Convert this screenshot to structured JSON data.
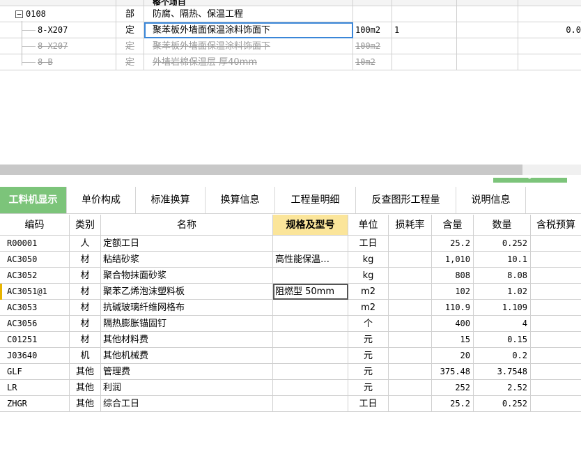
{
  "top": {
    "header_partial": "整个项目",
    "rows": [
      {
        "code": "0108",
        "type": "部",
        "name": "防腐、隔热、保温工程",
        "unit": "",
        "qty": "",
        "amount": "",
        "expander": "−",
        "strike": false
      },
      {
        "code": "8-X207",
        "type": "定",
        "name": "聚苯板外墙面保温涂料饰面下",
        "unit": "100m2",
        "qty": "1",
        "amount": "0.0",
        "strike": false
      },
      {
        "code": "8-X207",
        "type": "定",
        "name": "聚苯板外墙面保温涂料饰面下",
        "unit": "100m2",
        "qty": "",
        "amount": "",
        "strike": true
      },
      {
        "code": "8-B",
        "type": "定",
        "name": "外墙岩棉保温层 厚40mm",
        "unit": "10m2",
        "qty": "",
        "amount": "",
        "strike": true
      }
    ]
  },
  "tabs": [
    {
      "label": "工料机显示",
      "active": true
    },
    {
      "label": "单价构成",
      "active": false
    },
    {
      "label": "标准换算",
      "active": false
    },
    {
      "label": "换算信息",
      "active": false
    },
    {
      "label": "工程量明细",
      "active": false
    },
    {
      "label": "反查图形工程量",
      "active": false
    },
    {
      "label": "说明信息",
      "active": false
    }
  ],
  "grid": {
    "headers": [
      "编码",
      "类别",
      "名称",
      "规格及型号",
      "单位",
      "损耗率",
      "含量",
      "数量",
      "含税预算"
    ],
    "rows": [
      {
        "code": "R00001",
        "cat": "人",
        "name": "定额工日",
        "spec": "",
        "unit": "工日",
        "loss": "",
        "content": "25.2",
        "qty": "0.252"
      },
      {
        "code": "AC3050",
        "cat": "材",
        "name": "粘结砂浆",
        "spec": "高性能保温…",
        "unit": "kg",
        "loss": "",
        "content": "1,010",
        "qty": "10.1"
      },
      {
        "code": "AC3052",
        "cat": "材",
        "name": "聚合物抹面砂浆",
        "spec": "",
        "unit": "kg",
        "loss": "",
        "content": "808",
        "qty": "8.08"
      },
      {
        "code": "AC3051@1",
        "cat": "材",
        "name": "聚苯乙烯泡沫塑料板",
        "spec": "阻燃型 50mm",
        "unit": "m2",
        "loss": "",
        "content": "102",
        "qty": "1.02"
      },
      {
        "code": "AC3053",
        "cat": "材",
        "name": "抗碱玻璃纤维网格布",
        "spec": "",
        "unit": "m2",
        "loss": "",
        "content": "110.9",
        "qty": "1.109"
      },
      {
        "code": "AC3056",
        "cat": "材",
        "name": "隔热膨胀锚固钉",
        "spec": "",
        "unit": "个",
        "loss": "",
        "content": "400",
        "qty": "4"
      },
      {
        "code": "C01251",
        "cat": "材",
        "name": "其他材料费",
        "spec": "",
        "unit": "元",
        "loss": "",
        "content": "15",
        "qty": "0.15"
      },
      {
        "code": "J03640",
        "cat": "机",
        "name": "其他机械费",
        "spec": "",
        "unit": "元",
        "loss": "",
        "content": "20",
        "qty": "0.2"
      },
      {
        "code": "GLF",
        "cat": "其他",
        "name": "管理费",
        "spec": "",
        "unit": "元",
        "loss": "",
        "content": "375.48",
        "qty": "3.7548"
      },
      {
        "code": "LR",
        "cat": "其他",
        "name": "利润",
        "spec": "",
        "unit": "元",
        "loss": "",
        "content": "252",
        "qty": "2.52"
      },
      {
        "code": "ZHGR",
        "cat": "其他",
        "name": "综合工日",
        "spec": "",
        "unit": "工日",
        "loss": "",
        "content": "25.2",
        "qty": "0.252"
      }
    ]
  },
  "colors": {
    "accent_green": "#7cc47a",
    "header_highlight": "#fbe59a",
    "selection_blue": "#3a86d8"
  }
}
